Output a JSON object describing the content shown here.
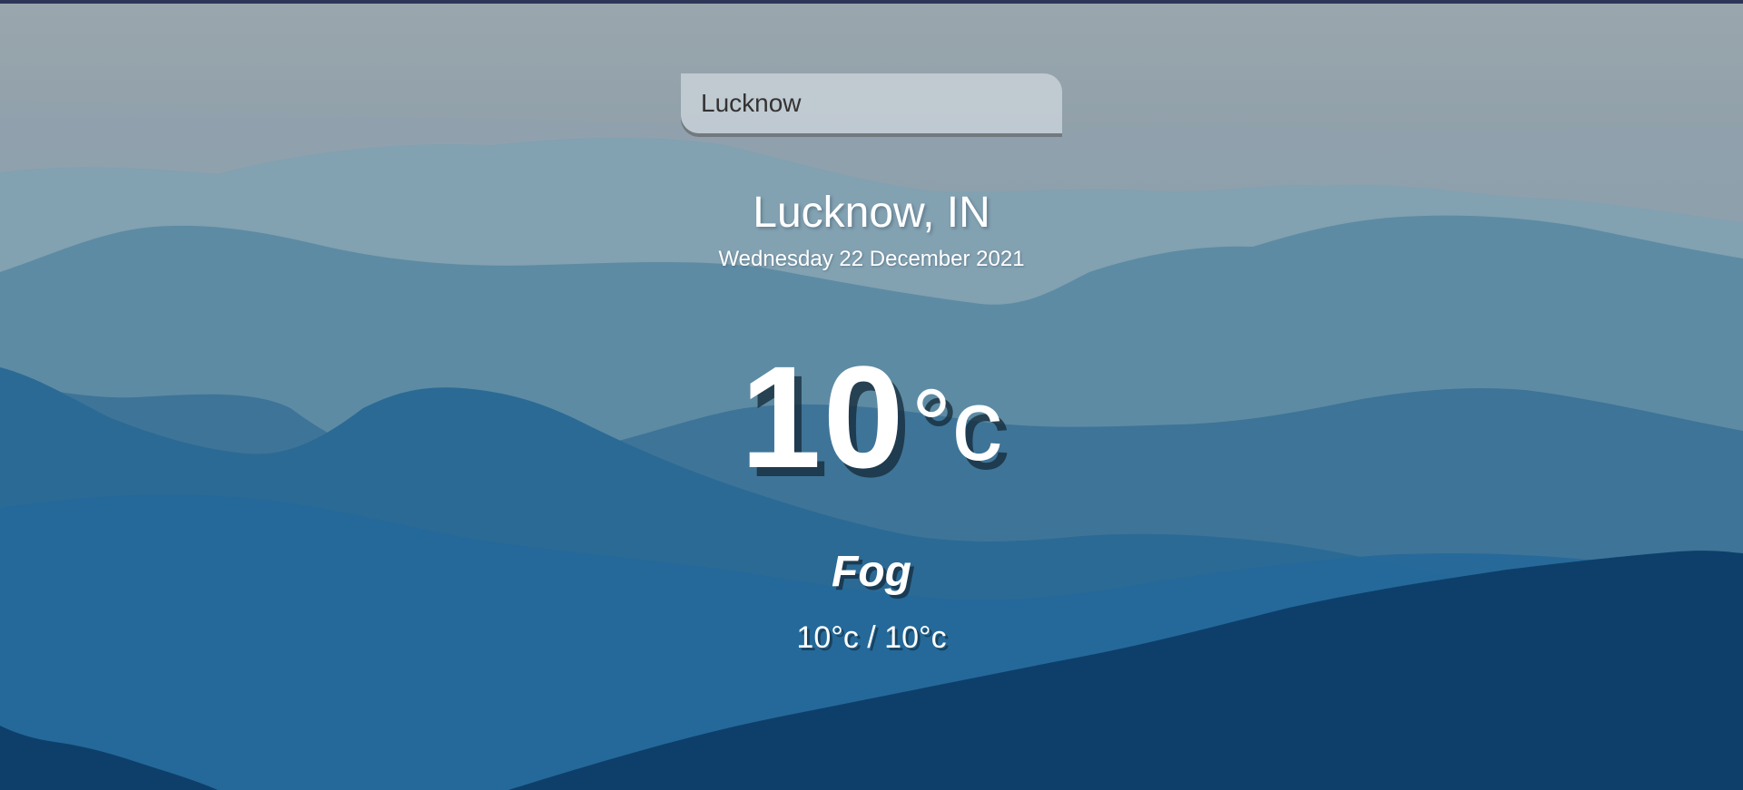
{
  "search": {
    "value": "Lucknow"
  },
  "location": {
    "city_country": "Lucknow, IN",
    "date": "Wednesday 22 December 2021"
  },
  "weather": {
    "temperature": "10",
    "unit": "°c",
    "condition": "Fog",
    "hi_low": "10°c / 10°c"
  },
  "colors": {
    "strip": "#2e3658",
    "sky": "#9aa6ad",
    "text": "#ffffff"
  },
  "background": {
    "icon": "mountain-landscape"
  }
}
